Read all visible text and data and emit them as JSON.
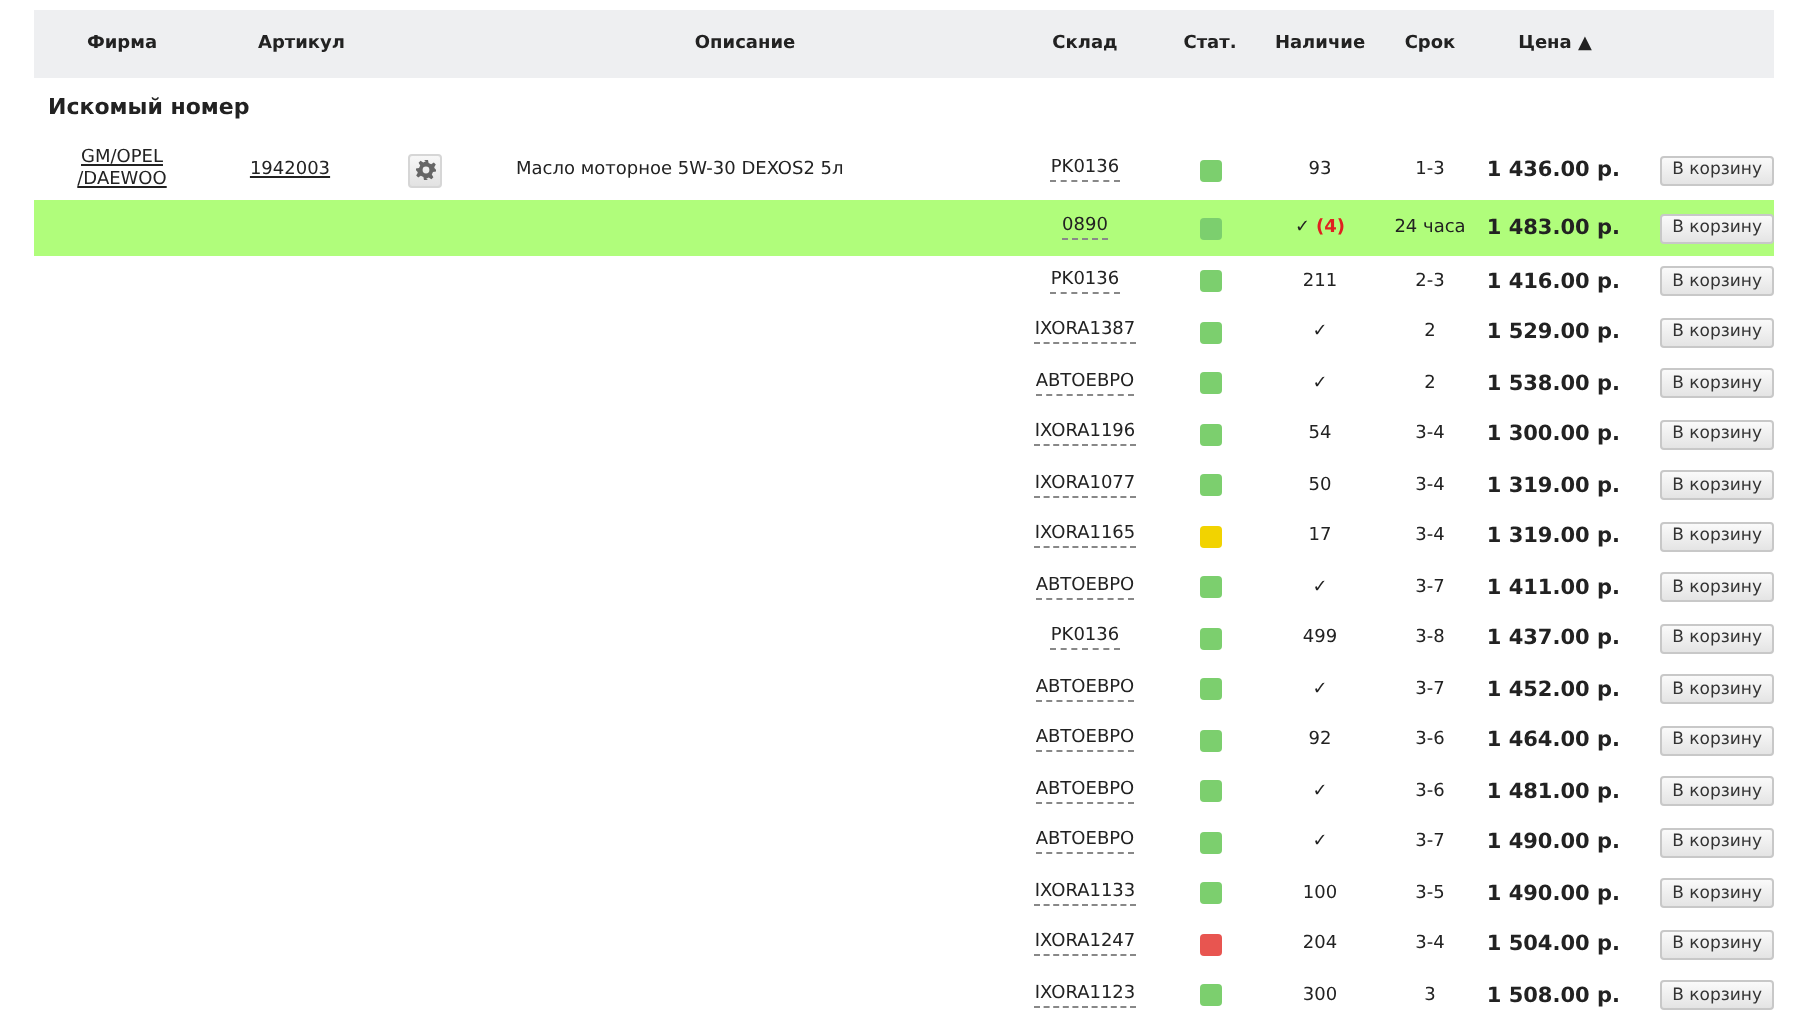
{
  "columns": [
    {
      "label": "Фирма"
    },
    {
      "label": "Артикул"
    },
    {
      "label": "Описание"
    },
    {
      "label": "Склад"
    },
    {
      "label": "Стат."
    },
    {
      "label": "Наличие"
    },
    {
      "label": "Срок"
    },
    {
      "label": "Цена",
      "sort": "▲"
    }
  ],
  "section_title": "Искомый номер",
  "part": {
    "brand": "GM/OPEL /DAEWOO",
    "article": "1942003",
    "description": "Масло моторное 5W-30 DEXOS2 5л"
  },
  "offers": [
    {
      "warehouse": "PK0136",
      "color": "#7ccf6e",
      "availability": "93",
      "term": "1-3",
      "price": "1 436.00 р.",
      "button": "В корзину",
      "selected": false
    },
    {
      "warehouse": "0890",
      "color": "#7ccf6e",
      "availability": "✓",
      "reserve": "(4)",
      "term": "24 часа",
      "price": "1 483.00 р.",
      "button": "В корзину",
      "selected": true
    },
    {
      "warehouse": "PK0136",
      "color": "#7ccf6e",
      "availability": "211",
      "term": "2-3",
      "price": "1 416.00 р.",
      "button": "В корзину",
      "selected": false
    },
    {
      "warehouse": "IXORA1387",
      "color": "#7ccf6e",
      "availability": "✓",
      "term": "2",
      "price": "1 529.00 р.",
      "button": "В корзину",
      "selected": false
    },
    {
      "warehouse": "АВТОЕВРО",
      "color": "#7ccf6e",
      "availability": "✓",
      "term": "2",
      "price": "1 538.00 р.",
      "button": "В корзину",
      "selected": false
    },
    {
      "warehouse": "IXORA1196",
      "color": "#7ccf6e",
      "availability": "54",
      "term": "3-4",
      "price": "1 300.00 р.",
      "button": "В корзину",
      "selected": false
    },
    {
      "warehouse": "IXORA1077",
      "color": "#7ccf6e",
      "availability": "50",
      "term": "3-4",
      "price": "1 319.00 р.",
      "button": "В корзину",
      "selected": false
    },
    {
      "warehouse": "IXORA1165",
      "color": "#f2d300",
      "availability": "17",
      "term": "3-4",
      "price": "1 319.00 р.",
      "button": "В корзину",
      "selected": false
    },
    {
      "warehouse": "АВТОЕВРО",
      "color": "#7ccf6e",
      "availability": "✓",
      "term": "3-7",
      "price": "1 411.00 р.",
      "button": "В корзину",
      "selected": false
    },
    {
      "warehouse": "PK0136",
      "color": "#7ccf6e",
      "availability": "499",
      "term": "3-8",
      "price": "1 437.00 р.",
      "button": "В корзину",
      "selected": false
    },
    {
      "warehouse": "АВТОЕВРО",
      "color": "#7ccf6e",
      "availability": "✓",
      "term": "3-7",
      "price": "1 452.00 р.",
      "button": "В корзину",
      "selected": false
    },
    {
      "warehouse": "АВТОЕВРО",
      "color": "#7ccf6e",
      "availability": "92",
      "term": "3-6",
      "price": "1 464.00 р.",
      "button": "В корзину",
      "selected": false
    },
    {
      "warehouse": "АВТОЕВРО",
      "color": "#7ccf6e",
      "availability": "✓",
      "term": "3-6",
      "price": "1 481.00 р.",
      "button": "В корзину",
      "selected": false
    },
    {
      "warehouse": "АВТОЕВРО",
      "color": "#7ccf6e",
      "availability": "✓",
      "term": "3-7",
      "price": "1 490.00 р.",
      "button": "В корзину",
      "selected": false
    },
    {
      "warehouse": "IXORA1133",
      "color": "#7ccf6e",
      "availability": "100",
      "term": "3-5",
      "price": "1 490.00 р.",
      "button": "В корзину",
      "selected": false
    },
    {
      "warehouse": "IXORA1247",
      "color": "#e85550",
      "availability": "204",
      "term": "3-4",
      "price": "1 504.00 р.",
      "button": "В корзину",
      "selected": false
    },
    {
      "warehouse": "IXORA1123",
      "color": "#7ccf6e",
      "availability": "300",
      "term": "3",
      "price": "1 508.00 р.",
      "button": "В корзину",
      "selected": false
    }
  ]
}
